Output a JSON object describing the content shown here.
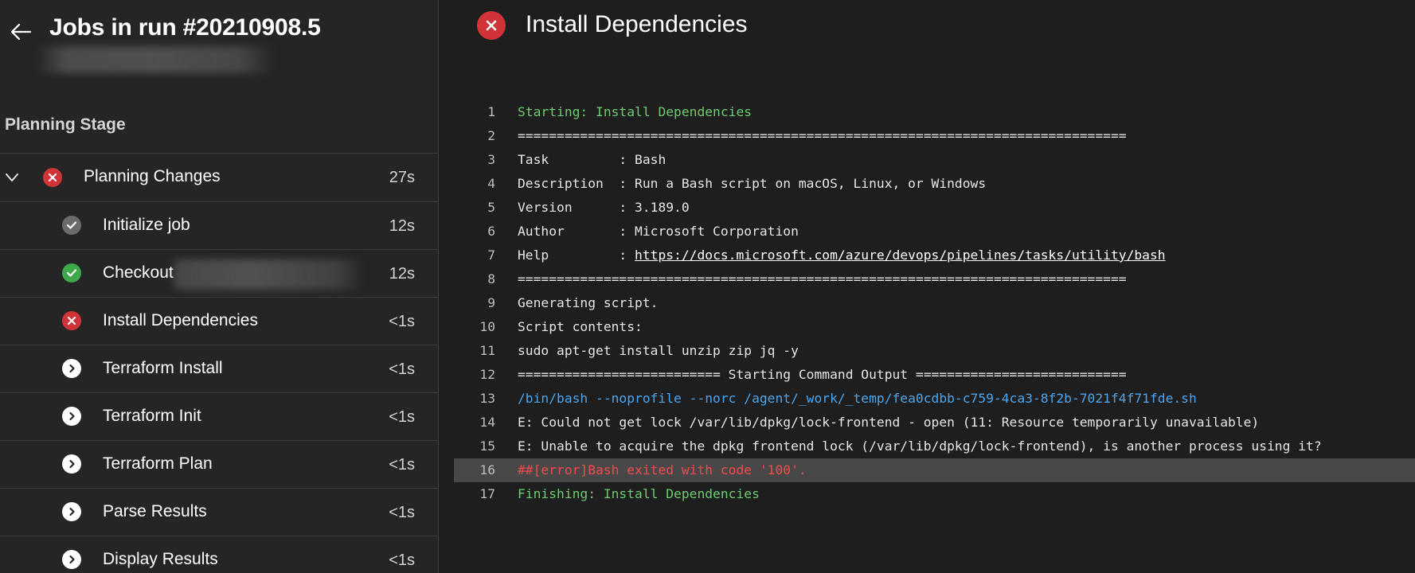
{
  "header": {
    "run_title": "Jobs in run #20210908.5"
  },
  "stage": {
    "title": "Planning Stage"
  },
  "job": {
    "name": "Planning Changes",
    "duration": "27s",
    "status": "failed",
    "expanded": true
  },
  "steps": [
    {
      "name": "Initialize job",
      "duration": "12s",
      "status": "succeeded-gray"
    },
    {
      "name": "Checkout",
      "duration": "12s",
      "status": "succeeded"
    },
    {
      "name": "Install Dependencies",
      "duration": "<1s",
      "status": "failed"
    },
    {
      "name": "Terraform Install",
      "duration": "<1s",
      "status": "skipped"
    },
    {
      "name": "Terraform Init",
      "duration": "<1s",
      "status": "skipped"
    },
    {
      "name": "Terraform Plan",
      "duration": "<1s",
      "status": "skipped"
    },
    {
      "name": "Parse Results",
      "duration": "<1s",
      "status": "skipped"
    },
    {
      "name": "Display Results",
      "duration": "<1s",
      "status": "skipped"
    }
  ],
  "main": {
    "title": "Install Dependencies",
    "status": "failed"
  },
  "log": {
    "lines": [
      {
        "n": "1",
        "text": "Starting: Install Dependencies",
        "style": "green"
      },
      {
        "n": "2",
        "text": "==============================================================================",
        "style": "plain"
      },
      {
        "n": "3",
        "text": "Task         : Bash",
        "style": "plain"
      },
      {
        "n": "4",
        "text": "Description  : Run a Bash script on macOS, Linux, or Windows",
        "style": "plain"
      },
      {
        "n": "5",
        "text": "Version      : 3.189.0",
        "style": "plain"
      },
      {
        "n": "6",
        "text": "Author       : Microsoft Corporation",
        "style": "plain"
      },
      {
        "n": "7",
        "text": "Help         : ",
        "link": "https://docs.microsoft.com/azure/devops/pipelines/tasks/utility/bash",
        "style": "plain"
      },
      {
        "n": "8",
        "text": "==============================================================================",
        "style": "plain"
      },
      {
        "n": "9",
        "text": "Generating script.",
        "style": "plain"
      },
      {
        "n": "10",
        "text": "Script contents:",
        "style": "plain"
      },
      {
        "n": "11",
        "text": "sudo apt-get install unzip zip jq -y",
        "style": "plain"
      },
      {
        "n": "12",
        "text": "========================== Starting Command Output ===========================",
        "style": "plain"
      },
      {
        "n": "13",
        "text": "/bin/bash --noprofile --norc /agent/_work/_temp/fea0cdbb-c759-4ca3-8f2b-7021f4f71fde.sh",
        "style": "blue"
      },
      {
        "n": "14",
        "text": "E: Could not get lock /var/lib/dpkg/lock-frontend - open (11: Resource temporarily unavailable)",
        "style": "plain"
      },
      {
        "n": "15",
        "text": "E: Unable to acquire the dpkg frontend lock (/var/lib/dpkg/lock-frontend), is another process using it?",
        "style": "plain"
      },
      {
        "n": "16",
        "text": "##[error]Bash exited with code '100'.",
        "style": "error"
      },
      {
        "n": "17",
        "text": "Finishing: Install Dependencies",
        "style": "green"
      }
    ]
  },
  "colors": {
    "failed": "#d13438",
    "succeeded": "#3ea84a",
    "succeeded-gray": "#6b6b6b",
    "skipped_fill": "#ffffff",
    "skipped_glyph": "#252526",
    "log_green": "#6ccb6f",
    "log_blue": "#4aa6f0",
    "log_error": "#f14c4c"
  },
  "icons": {
    "back": "arrow-left-icon",
    "chevron": "chevron-down-icon",
    "failed": "error-circle-icon",
    "succeeded": "check-circle-icon",
    "skipped": "skipped-circle-icon"
  }
}
